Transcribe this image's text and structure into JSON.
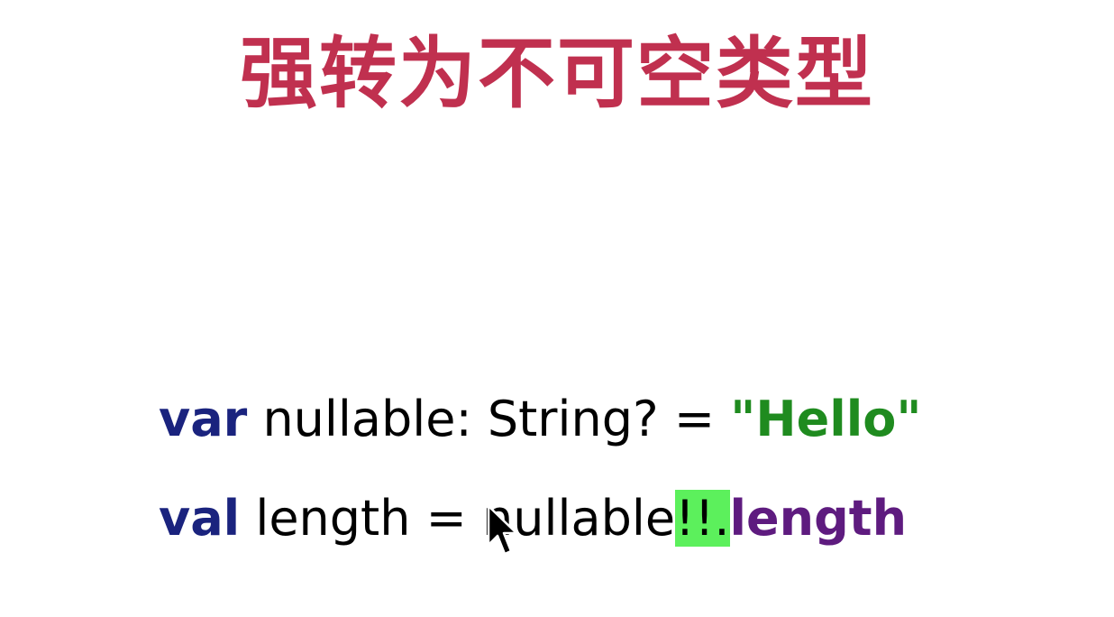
{
  "slide": {
    "title": "强转为不可空类型",
    "title_color": "#c0304f"
  },
  "code": {
    "line1": {
      "keyword": "var",
      "text": " nullable: String? = ",
      "string_literal": "\"Hello\""
    },
    "line2": {
      "keyword": "val",
      "text": " length = nullable",
      "operator": "!!",
      "dot": ".",
      "property": "length"
    },
    "colors": {
      "keyword": "#1a237e",
      "string": "#1f8b1f",
      "property": "#5e1b7f",
      "highlight": "#5cf05c"
    }
  },
  "cursor": {
    "icon": "mouse-pointer-icon"
  }
}
